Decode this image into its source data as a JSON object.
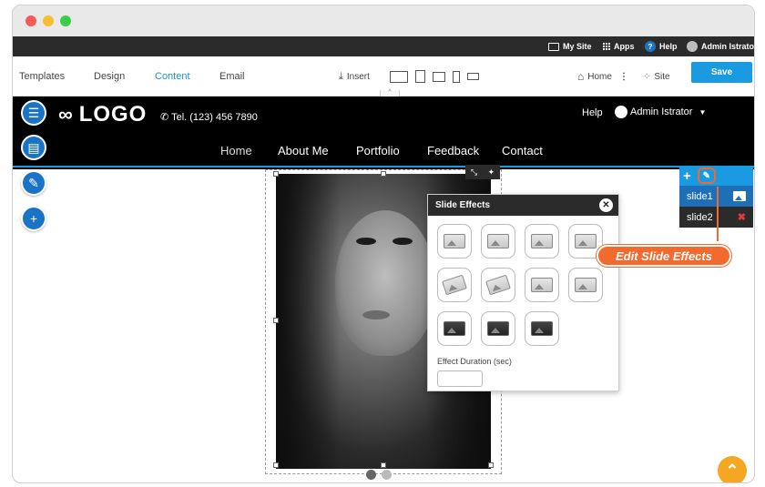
{
  "admin_bar": {
    "my_site": "My Site",
    "apps": "Apps",
    "help": "Help",
    "user": "Admin Istrator"
  },
  "toolbar": {
    "tabs": [
      "Templates",
      "Design",
      "Content",
      "Email"
    ],
    "active_tab": "Content",
    "insert": "Insert",
    "home": "Home",
    "site": "Site",
    "save": "Save"
  },
  "site_header": {
    "logo": "LOGO",
    "tel": "Tel. (123) 456 7890",
    "help": "Help",
    "user": "Admin Istrator",
    "nav": [
      "Home",
      "About Me",
      "Portfolio",
      "Feedback",
      "Contact"
    ]
  },
  "slide_effects": {
    "title": "Slide Effects",
    "duration_label": "Effect Duration (sec)",
    "duration_value": ""
  },
  "slides": {
    "items": [
      "slide1",
      "slide2"
    ]
  },
  "callout": "Edit Slide Effects",
  "colors": {
    "accent": "#1a9ae0",
    "callout": "#f26a2e",
    "header_bg": "#000000"
  }
}
